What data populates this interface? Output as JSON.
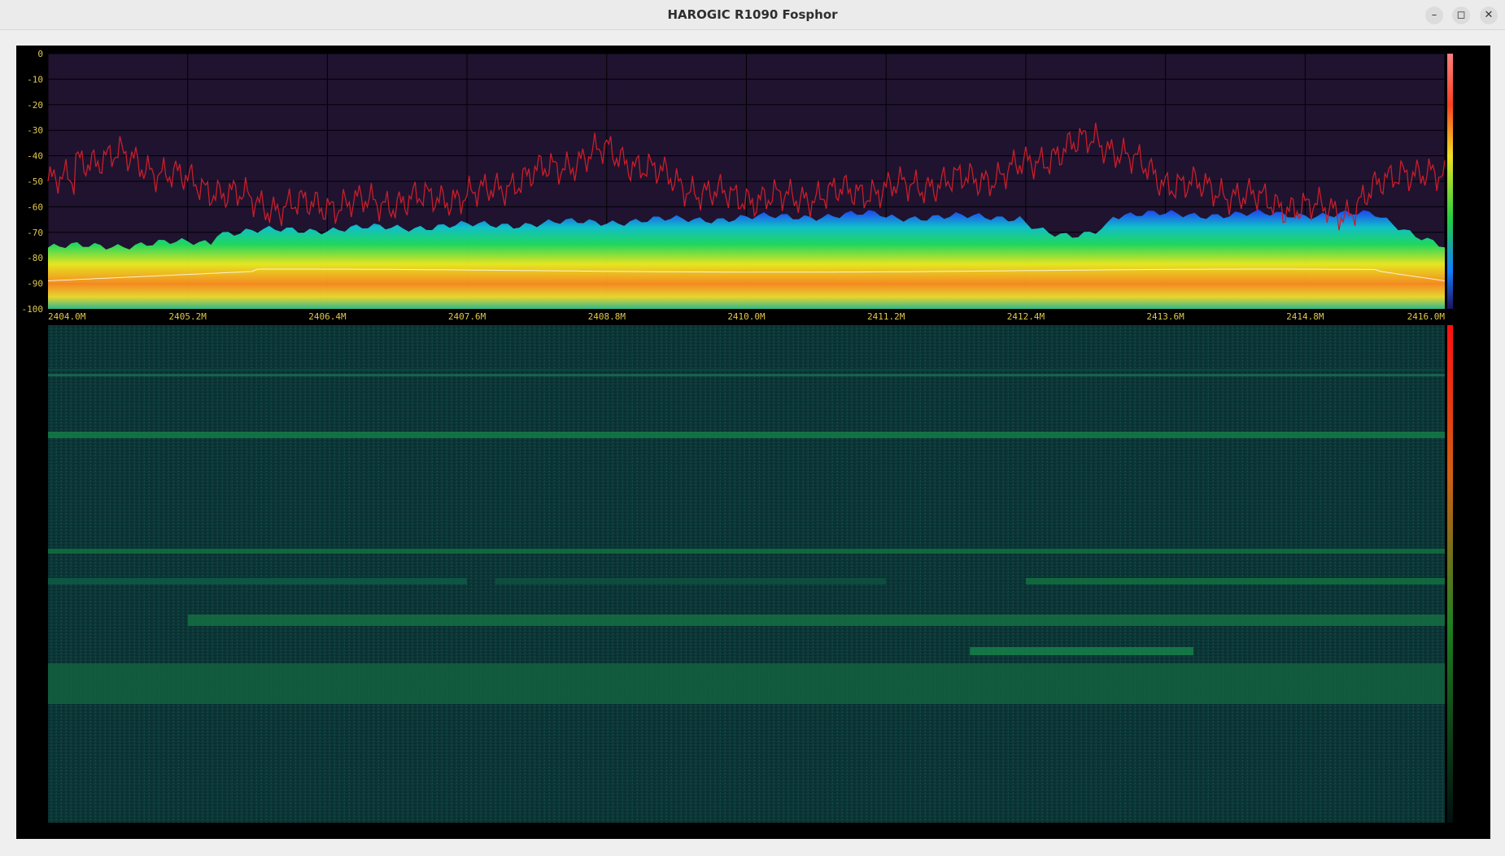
{
  "window": {
    "title": "HAROGIC R1090 Fosphor",
    "buttons": {
      "minimize": "–",
      "restore": "◻",
      "close": "✕"
    }
  },
  "spectrum": {
    "y_axis_labels": [
      "0",
      "-10",
      "-20",
      "-30",
      "-40",
      "-50",
      "-60",
      "-70",
      "-80",
      "-90",
      "-100"
    ],
    "x_axis_labels": [
      "2404.0M",
      "2405.2M",
      "2406.4M",
      "2407.6M",
      "2408.8M",
      "2410.0M",
      "2411.2M",
      "2412.4M",
      "2413.6M",
      "2414.8M",
      "2416.0M"
    ],
    "colors": {
      "max_hold_trace": "#c81e2a",
      "avg_trace": "#ffffff",
      "axis_text": "#e0c84a",
      "plot_bg": "#1f1330"
    }
  },
  "waterfall": {
    "colors": {
      "base": "#0b3a3a",
      "signal": "#137a4a"
    }
  }
}
